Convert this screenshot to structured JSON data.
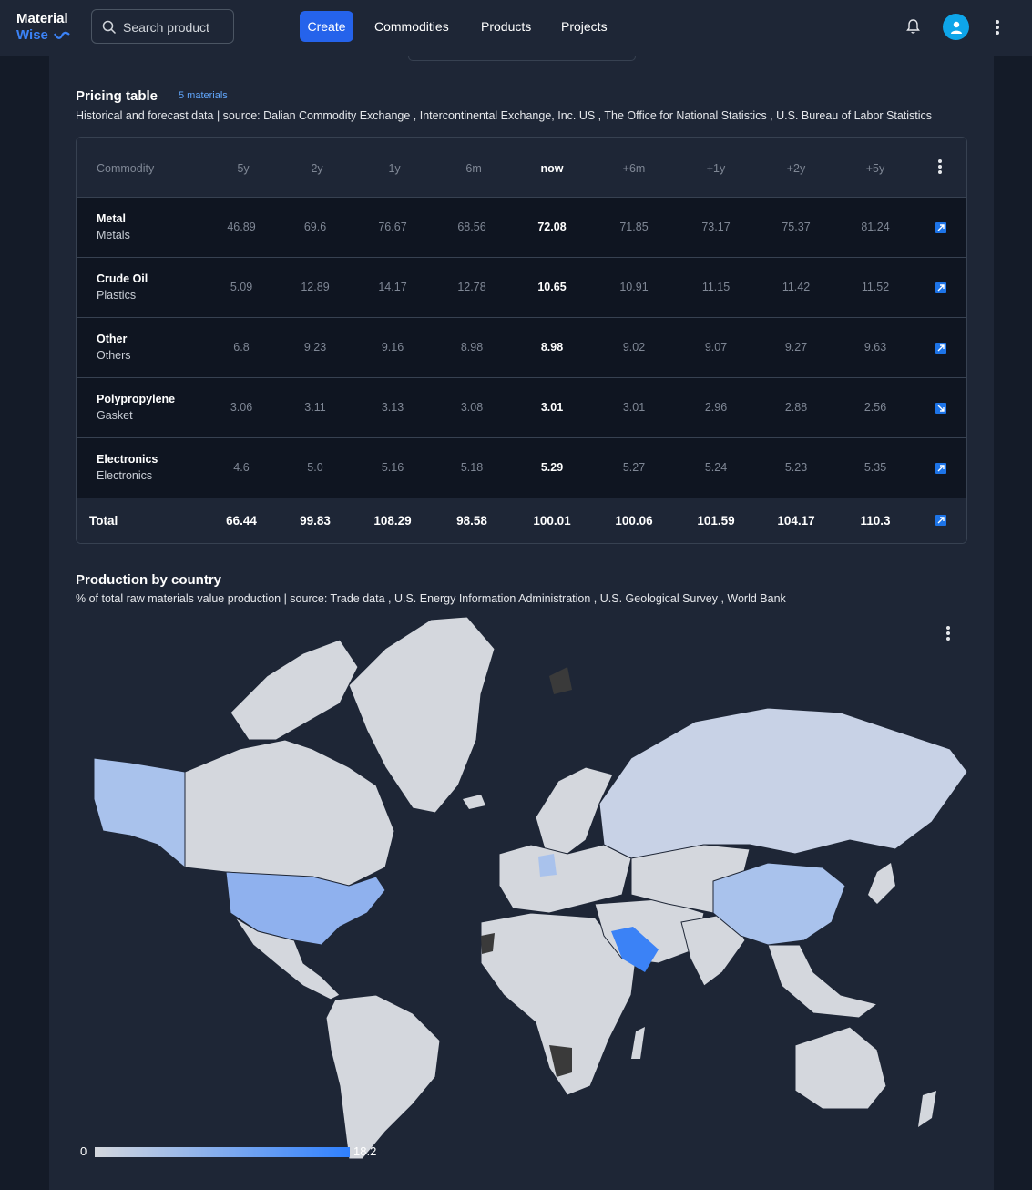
{
  "header": {
    "logo_line1": "Material",
    "logo_line2": "Wise",
    "search_placeholder": "Search product",
    "create_label": "Create",
    "nav": [
      "Commodities",
      "Products",
      "Projects"
    ]
  },
  "pricing": {
    "title": "Pricing table",
    "badge": "5 materials",
    "subtitle": "Historical and forecast data | source: Dalian Commodity Exchange , Intercontinental Exchange, Inc. US , The Office for National Statistics , U.S. Bureau of Labor Statistics",
    "columns": [
      "Commodity",
      "-5y",
      "-2y",
      "-1y",
      "-6m",
      "now",
      "+6m",
      "+1y",
      "+2y",
      "+5y"
    ],
    "rows": [
      {
        "name": "Metal",
        "category": "Metals",
        "values": [
          "46.89",
          "69.6",
          "76.67",
          "68.56",
          "72.08",
          "71.85",
          "73.17",
          "75.37",
          "81.24"
        ],
        "trend": "up"
      },
      {
        "name": "Crude Oil",
        "category": "Plastics",
        "values": [
          "5.09",
          "12.89",
          "14.17",
          "12.78",
          "10.65",
          "10.91",
          "11.15",
          "11.42",
          "11.52"
        ],
        "trend": "up"
      },
      {
        "name": "Other",
        "category": "Others",
        "values": [
          "6.8",
          "9.23",
          "9.16",
          "8.98",
          "8.98",
          "9.02",
          "9.07",
          "9.27",
          "9.63"
        ],
        "trend": "up"
      },
      {
        "name": "Polypropylene",
        "category": "Gasket",
        "values": [
          "3.06",
          "3.11",
          "3.13",
          "3.08",
          "3.01",
          "3.01",
          "2.96",
          "2.88",
          "2.56"
        ],
        "trend": "down"
      },
      {
        "name": "Electronics",
        "category": "Electronics",
        "values": [
          "4.6",
          "5.0",
          "5.16",
          "5.18",
          "5.29",
          "5.27",
          "5.24",
          "5.23",
          "5.35"
        ],
        "trend": "up"
      }
    ],
    "total": {
      "label": "Total",
      "values": [
        "66.44",
        "99.83",
        "108.29",
        "98.58",
        "100.01",
        "100.06",
        "101.59",
        "104.17",
        "110.3"
      ],
      "trend": "up"
    }
  },
  "production": {
    "title": "Production by country",
    "subtitle": "% of total raw materials value production | source: Trade data , U.S. Energy Information Administration , U.S. Geological Survey , World Bank",
    "legend_min": "0",
    "legend_max": "18.2",
    "colors": {
      "land": "#d4d7dd",
      "light_blue": "#a9c2ec",
      "mid_blue": "#8fb1ee",
      "strong_blue": "#3b82f6",
      "no_data": "#3a3a3a",
      "ocean": "#1e2636"
    }
  }
}
